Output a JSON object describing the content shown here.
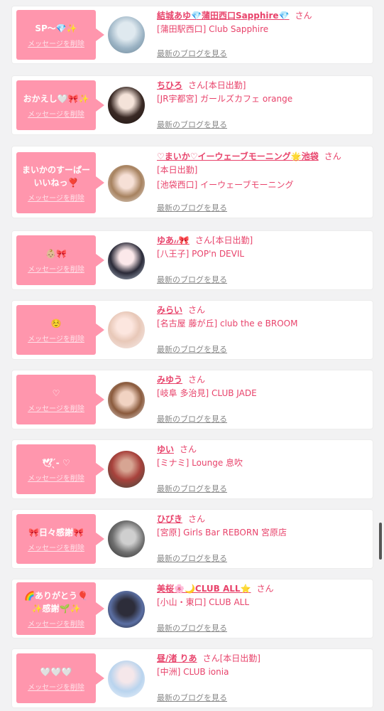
{
  "delete_label": "メッセージを削除",
  "san_label": "さん",
  "blog_label": "最新のブログを見る",
  "colors": {
    "accent": "#ff96ad",
    "name": "#e8436b",
    "background": "#f2f2f3"
  },
  "entries": [
    {
      "message": "SP〜💎✨",
      "name": "結城あゆ💎蒲田西口Sapphire💎",
      "status": "",
      "shops": [
        "[蒲田駅西口] Club Sapphire"
      ]
    },
    {
      "message": "おかえし🤍🎀✨",
      "name": "ちひろ",
      "status": "[本日出勤]",
      "shops": [
        "[JR宇都宮] ガールズカフェ orange"
      ]
    },
    {
      "message": "まいかのすーぱー\nいいねっ❣️",
      "name": "♡まいか♡イーウェーブモーニング🌟池袋",
      "status": "",
      "shops": [
        "[本日出勤]",
        "[池袋西口] イーウェーブモーニング"
      ]
    },
    {
      "message": "👶🏼🎀",
      "name": "ゆあ៸៸🎀",
      "status": "[本日出勤]",
      "shops": [
        "[八王子] POP'n DEVIL"
      ]
    },
    {
      "message": "☺️",
      "name": "みらい",
      "status": "",
      "shops": [
        "[名古屋 藤が丘] club the e BROOM"
      ]
    },
    {
      "message": "♡",
      "name": "みゆう",
      "status": "",
      "shops": [
        "[岐阜 多治見] CLUB JADE"
      ]
    },
    {
      "message": "🕊 ̖́-‬ ♡",
      "name": "ゆい",
      "status": "",
      "shops": [
        "[ミナミ] Lounge 息吹"
      ]
    },
    {
      "message": "🎀日々感謝🎀",
      "name": "ひびき",
      "status": "",
      "shops": [
        "[宮原] Girls Bar REBORN 宮原店"
      ]
    },
    {
      "message": "🌈ありがとう🎈\n✨感謝🌱✨",
      "name": "美桜🌸🌙CLUB ALL⭐",
      "status": "",
      "shops": [
        "[小山・東口] CLUB ALL"
      ]
    },
    {
      "message": "🤍🤍🤍",
      "name": "昼/渚 りあ",
      "status": "[本日出勤]",
      "shops": [
        "[中洲] CLUB ionia"
      ]
    }
  ]
}
